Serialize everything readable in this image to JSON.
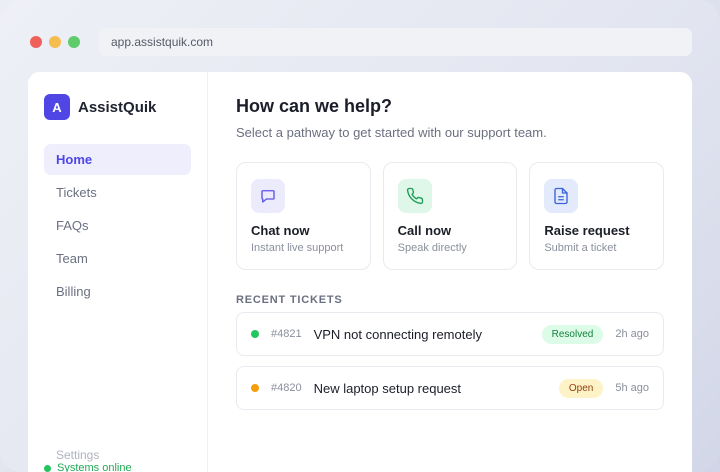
{
  "browser": {
    "url": "app.assistquik.com"
  },
  "brand": {
    "logo_letter": "A",
    "name": "AssistQuik",
    "accent": "#4f46e5"
  },
  "sidebar": {
    "items": [
      {
        "label": "Home",
        "active": true
      },
      {
        "label": "Tickets",
        "active": false
      },
      {
        "label": "FAQs",
        "active": false
      },
      {
        "label": "Team",
        "active": false
      },
      {
        "label": "Billing",
        "active": false
      }
    ],
    "settings_label": "Settings",
    "status_text": "Systems online",
    "status_color": "#22c55e"
  },
  "main": {
    "title": "How can we help?",
    "subtitle": "Select a pathway to get started with our support team.",
    "cards": [
      {
        "icon": "chat-bubble-icon",
        "title": "Chat now",
        "subtitle": "Instant live support"
      },
      {
        "icon": "phone-icon",
        "title": "Call now",
        "subtitle": "Speak directly"
      },
      {
        "icon": "document-icon",
        "title": "Raise request",
        "subtitle": "Submit a ticket"
      }
    ],
    "recent_label": "RECENT TICKETS",
    "tickets": [
      {
        "id": "#4821",
        "title": "VPN not connecting remotely",
        "status": "Resolved",
        "status_color": "#22c55e",
        "badge_bg": "#dcfce7",
        "badge_fg": "#15803d",
        "time": "2h ago"
      },
      {
        "id": "#4820",
        "title": "New laptop setup request",
        "status": "Open",
        "status_color": "#f59e0b",
        "badge_bg": "#fef3c7",
        "badge_fg": "#92400e",
        "time": "5h ago"
      }
    ]
  }
}
